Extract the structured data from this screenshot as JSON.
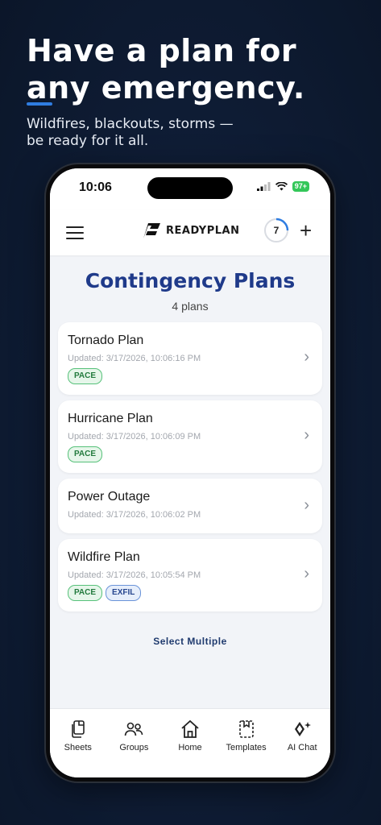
{
  "hero": {
    "headline_line1": "Have a plan for",
    "headline_line2": "any emergency.",
    "subline_line1": "Wildfires, blackouts, storms —",
    "subline_line2": "be ready for it all."
  },
  "statusbar": {
    "time": "10:06",
    "battery": "97+"
  },
  "appbar": {
    "brand": "READYPLAN",
    "badge_count": "7",
    "add_label": "+"
  },
  "page": {
    "title": "Contingency Plans",
    "count": "4 plans",
    "select_multiple": "Select Multiple"
  },
  "plans": [
    {
      "title": "Tornado Plan",
      "updated": "Updated: 3/17/2026, 10:06:16 PM",
      "tags": [
        "PACE"
      ]
    },
    {
      "title": "Hurricane Plan",
      "updated": "Updated: 3/17/2026, 10:06:09 PM",
      "tags": [
        "PACE"
      ]
    },
    {
      "title": "Power Outage",
      "updated": "Updated: 3/17/2026, 10:06:02 PM",
      "tags": []
    },
    {
      "title": "Wildfire Plan",
      "updated": "Updated: 3/17/2026, 10:05:54 PM",
      "tags": [
        "PACE",
        "EXFIL"
      ]
    }
  ],
  "tabs": [
    {
      "label": "Sheets",
      "icon": "sheets-icon"
    },
    {
      "label": "Groups",
      "icon": "groups-icon"
    },
    {
      "label": "Home",
      "icon": "home-icon"
    },
    {
      "label": "Templates",
      "icon": "templates-icon"
    },
    {
      "label": "AI Chat",
      "icon": "ai-chat-icon"
    }
  ],
  "colors": {
    "background": "#0f1d36",
    "accent_blue": "#2f7de1",
    "title_blue": "#1f3a8a",
    "pace_green": "#227a3d",
    "exfil_blue": "#27468f"
  }
}
